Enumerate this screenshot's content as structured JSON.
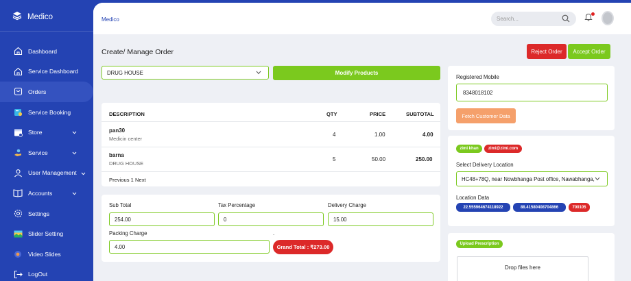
{
  "app": {
    "name": "Medico"
  },
  "sidebar": {
    "items": [
      {
        "label": "Dashboard",
        "icon": "home-icon"
      },
      {
        "label": "Service Dashboard",
        "icon": "home-icon"
      },
      {
        "label": "Orders",
        "icon": "orders-icon",
        "active": true
      },
      {
        "label": "Service Booking",
        "icon": "service-booking-icon"
      },
      {
        "label": "Store",
        "icon": "store-icon",
        "chevron": true
      },
      {
        "label": "Service",
        "icon": "service-icon",
        "chevron": true
      },
      {
        "label": "User Management",
        "icon": "user-icon",
        "chevron": true
      },
      {
        "label": "Accounts",
        "icon": "accounts-book-icon",
        "chevron": true
      },
      {
        "label": "Settings",
        "icon": "gear-icon"
      },
      {
        "label": "Slider Setting",
        "icon": "slider-image-icon"
      },
      {
        "label": "Video Slides",
        "icon": "video-icon"
      },
      {
        "label": "LogOut",
        "icon": "logout-icon"
      }
    ]
  },
  "topbar": {
    "breadcrumb": "Medico",
    "search_placeholder": "Search..."
  },
  "page": {
    "title": "Create/ Manage Order",
    "reject_label": "Reject Order",
    "accept_label": "Accept Order"
  },
  "order": {
    "store_select": "DRUG HOUSE",
    "modify_label": "Modify Products",
    "table": {
      "headers": {
        "description": "DESCRIPTION",
        "qty": "QTY",
        "price": "PRICE",
        "subtotal": "SUBTOTAL"
      },
      "rows": [
        {
          "name": "pan30",
          "store": "Medicin center",
          "qty": "4",
          "price": "1.00",
          "subtotal": "4.00"
        },
        {
          "name": "barna",
          "store": "DRUG HOUSE",
          "qty": "5",
          "price": "50.00",
          "subtotal": "250.00"
        }
      ],
      "pagination": "Previous 1 Next"
    }
  },
  "totals": {
    "sub_total_label": "Sub Total",
    "sub_total_value": "254.00",
    "tax_label": "Tax Percentage",
    "tax_value": "0",
    "delivery_label": "Delivery Charge",
    "delivery_value": "15.00",
    "packing_label": "Packing Charge",
    "packing_value": "4.00",
    "dot": ".",
    "grand_total": "Grand Total : ₹273.00"
  },
  "customer": {
    "mobile_label": "Registered Mobile",
    "mobile_value": "8348018102",
    "fetch_label": "Fetch Customer Data"
  },
  "delivery": {
    "name_badge": "zimi khan",
    "email_badge": "zimi@zimi.com",
    "location_label": "Select Delivery Location",
    "location_value": "HC48+78Q, near Nowbhanga Post office, Nawabhanga,",
    "location_data_label": "Location Data",
    "lat_badge": "22.555964674118922",
    "lng_badge": "88.41580408704866",
    "pin_badge": "700105"
  },
  "prescription": {
    "upload_badge": "Upload Prescription",
    "drop_text": "Drop files here"
  },
  "colors": {
    "sidebar": "#2443b3",
    "green": "#7bc91e",
    "red": "#dc2929",
    "orange": "#f5a06b",
    "navy_pill": "#2443b3"
  }
}
